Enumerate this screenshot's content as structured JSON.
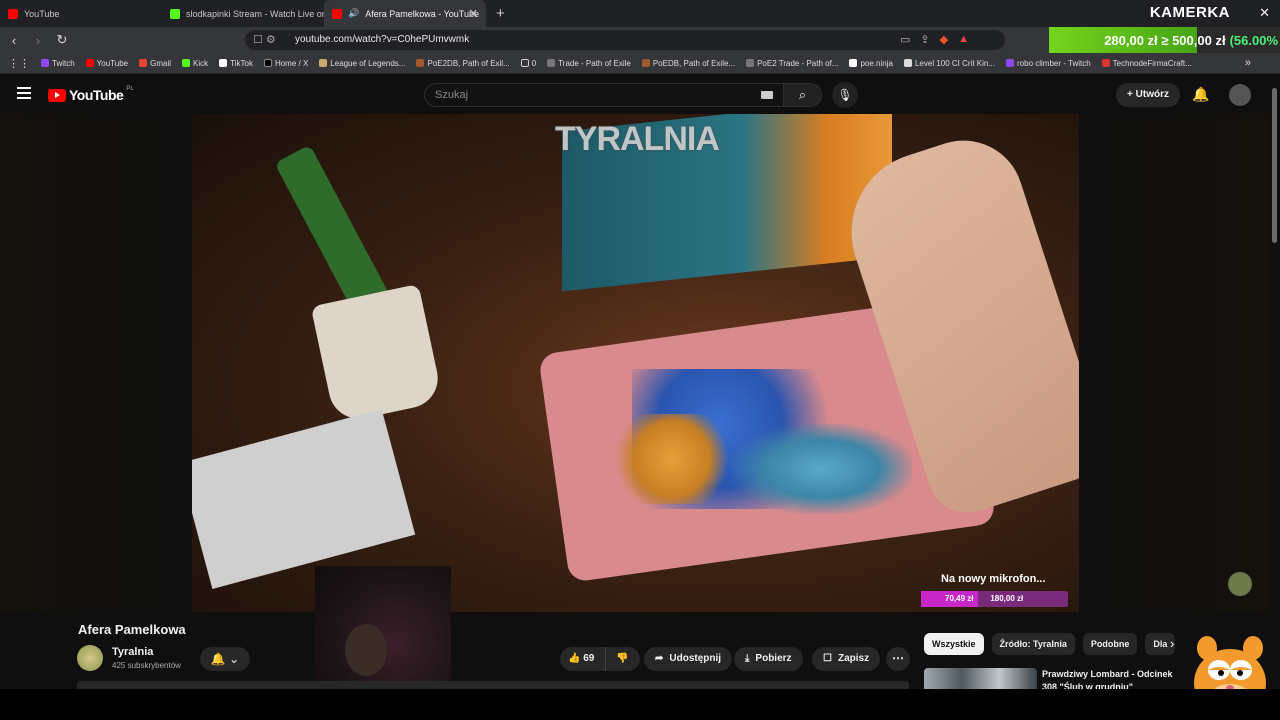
{
  "browser": {
    "tabs": [
      {
        "title": "YouTube",
        "favicon": "youtube-icon",
        "active": false
      },
      {
        "title": "slodkapinki Stream - Watch Live on K",
        "favicon": "kick-icon",
        "active": false
      },
      {
        "title": "Afera Pamelkowa - YouTube",
        "favicon": "youtube-icon",
        "active": true,
        "audio_icon": "speaker-icon"
      }
    ],
    "new_tab": "+",
    "window_close": "✕",
    "url": "youtube.com/watch?v=C0hePUmvwmk",
    "bookmarks": [
      "Twitch",
      "YouTube",
      "Gmail",
      "Kick",
      "TikTok",
      "Home / X",
      "League of Legends...",
      "PoE2DB, Path of Exil...",
      "0",
      "Trade - Path of Exile",
      "PoEDB, Path of Exile...",
      "PoE2 Trade - Path of...",
      "poe.ninja",
      "Level 100 CI Crit Kin...",
      "robo climber - Twitch",
      "TechnodeFirmaCraft..."
    ],
    "bookmarks_more": "»"
  },
  "overlay": {
    "kamerka": "KAMERKA",
    "goal_current": "280,00 zł",
    "goal_sep": "≥",
    "goal_target": "500,00 zł",
    "goal_pct": "(56.00%",
    "accent": "#74d41c"
  },
  "youtube": {
    "logo_text": "YouTube",
    "logo_region": "PL",
    "search_placeholder": "Szukaj",
    "create_label": "Utwórz"
  },
  "video": {
    "overlay_title": "TYRALNIA",
    "mic_goal_label": "Na nowy mikrofon...",
    "mic_goal_current": "70,49 zł",
    "mic_goal_target": "180,00 zł",
    "mic_goal_progress": 0.39,
    "mic_accent": "#c727c8"
  },
  "meta": {
    "title": "Afera Pamelkowa",
    "channel": "Tyralnia",
    "subscribers": "425 subskrybentów",
    "likes": "69",
    "share": "Udostępnij",
    "download": "Pobierz",
    "save": "Zapisz"
  },
  "sidebar": {
    "chips": [
      "Wszystkie",
      "Źródło: Tyralnia",
      "Podobne",
      "Dla"
    ],
    "rec_title": "Prawdziwy Lombard - Odcinek 308 \"Ślub w grudniu\""
  }
}
